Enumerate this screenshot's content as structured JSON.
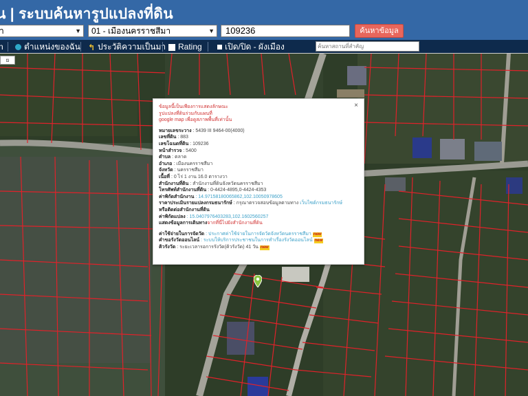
{
  "header": {
    "title": "น | ระบบค้นหารูปแปลงที่ดิน"
  },
  "search": {
    "province": "า",
    "district": "01 - เมืองนครราชสีมา",
    "parcel_no": "109236",
    "button": "ค้นหาข้อมูล"
  },
  "toolbar": {
    "items": [
      {
        "label": "ตำแหน่งของฉัน",
        "icon": "location-dot-icon"
      },
      {
        "label": "ประวัติความเป็นมา",
        "icon": "history-icon"
      },
      {
        "label": "Rating",
        "icon": "rating-chart-icon"
      },
      {
        "label": "เปิด/ปิด - ผังเมือง",
        "icon": "square-icon"
      }
    ],
    "place_placeholder": "ค้นหาสถานที่สำคัญ"
  },
  "map": {
    "zoom_label": "ย"
  },
  "popup": {
    "close": "×",
    "warning_line1": "ข้อมูลนี้เป็นเพียงการแสดงลักษณะ",
    "warning_line2": "รูปแปลงที่ดินร่วมกับแผนที่",
    "warning_line3": "google map เพื่อดูสภาพพื้นที่เท่านั้น",
    "fields": [
      {
        "label": "หมายเลขระวาง",
        "value": ": 5439 III 9464-00(4000)"
      },
      {
        "label": "เลขที่ดิน",
        "value": ": 883"
      },
      {
        "label": "เลขโฉนดที่ดิน",
        "value": ": 109236"
      },
      {
        "label": "หน้าสำรวจ",
        "value": ": 5400"
      },
      {
        "label": "ตำบล",
        "value": ": ตลาด"
      },
      {
        "label": "อำเภอ",
        "value": ": เมืองนครราชสีมา"
      },
      {
        "label": "จังหวัด",
        "value": ": นครราชสีมา"
      },
      {
        "label": "เนื้อที่",
        "value": ": 0 ไร่ 1 งาน 16.0 ตารางวา"
      },
      {
        "label": "สำนักงานที่ดิน",
        "value": ": สำนักงานที่ดินจังหวัดนครราชสีมา"
      },
      {
        "label": "โทรศัพท์สำนักงานที่ดิน",
        "value": ": 0-4424-4895,0-4424-4353"
      }
    ],
    "office_coord_label": "ค่าพิกัดสำนักงาน",
    "office_coord_value": ": 14.97158180065862,102.10050978605",
    "appraisal_label": "ราคาประเมินรายแปลงกรมธนารักษ์",
    "appraisal_value": ": กรุณาตรวจสอบข้อมูลตามทาง",
    "appraisal_link": "เว็บไซต์กรมธนารักษ์",
    "appraisal_line2": "หรือติดต่อสำนักงานที่ดิน",
    "parcel_coord_label": "ค่าพิกัดแปลง",
    "parcel_coord_value": ": 15.0407976403283,102.1602560257",
    "directions_label": "แสดงข้อมูลการเดินทาง",
    "directions_link": "จากที่นี่ไปยังสำนักงานที่ดิน",
    "fee_label": "ค่าใช้จ่ายในการจัดวัด",
    "fee_link": ": ประกาศค่าใช้จ่ายในการจัดวัดจังหวัดนครราชสีมา",
    "fee_badge": "new",
    "online_label": "คำขอรังวัดออนไลน์",
    "online_link": ": ระบบให้บริการประชาชนในการทำเรื่องรังวัดออนไลน์",
    "online_badge": "new",
    "queue_label": "คิวรังวัด",
    "queue_value": ": ระยะเวลารอการรังวัด(คิวรังวัด) 41 วัน",
    "queue_badge": "new"
  },
  "colors": {
    "header_bg": "#3468a6",
    "toolbar_bg": "#0e2a4c",
    "search_button": "#e8665c",
    "parcel_lines": "#e0222a",
    "warning_text": "#d03030",
    "link_text": "#3ca0c8"
  }
}
